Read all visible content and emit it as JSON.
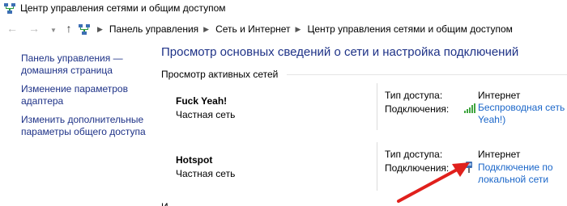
{
  "window": {
    "title": "Центр управления сетями и общим доступом"
  },
  "addressbar": {
    "crumbs": [
      "Панель управления",
      "Сеть и Интернет",
      "Центр управления сетями и общим доступом"
    ]
  },
  "sidebar": {
    "items": [
      {
        "line1": "Панель управления —",
        "line2": "домашняя страница"
      },
      {
        "line1": "Изменение параметров",
        "line2": "адаптера"
      },
      {
        "line1": "Изменить дополнительные",
        "line2": "параметры общего доступа"
      }
    ]
  },
  "main": {
    "title": "Просмотр основных сведений о сети и настройка подключений",
    "section_label": "Просмотр активных сетей",
    "networks": [
      {
        "name": "Fuck Yeah!",
        "type": "Частная сеть",
        "access_label": "Тип доступа:",
        "access_value": "Интернет",
        "connections_label": "Подключения:",
        "connection_line1": "Беспроводная сеть (Fuck",
        "connection_line2": "Yeah!)",
        "connection_icon": "wifi-signal-icon"
      },
      {
        "name": "Hotspot",
        "type": "Частная сеть",
        "access_label": "Тип доступа:",
        "access_value": "Интернет",
        "connections_label": "Подключения:",
        "connection_line1": "Подключение по",
        "connection_line2": "локальной сети",
        "connection_icon": "ethernet-icon"
      }
    ],
    "cut_off_text": "И"
  },
  "colors": {
    "link": "#1a66c9",
    "heading": "#1e3287",
    "annotation_arrow": "#e0201c",
    "wifi_bars": "#3fa53f"
  }
}
